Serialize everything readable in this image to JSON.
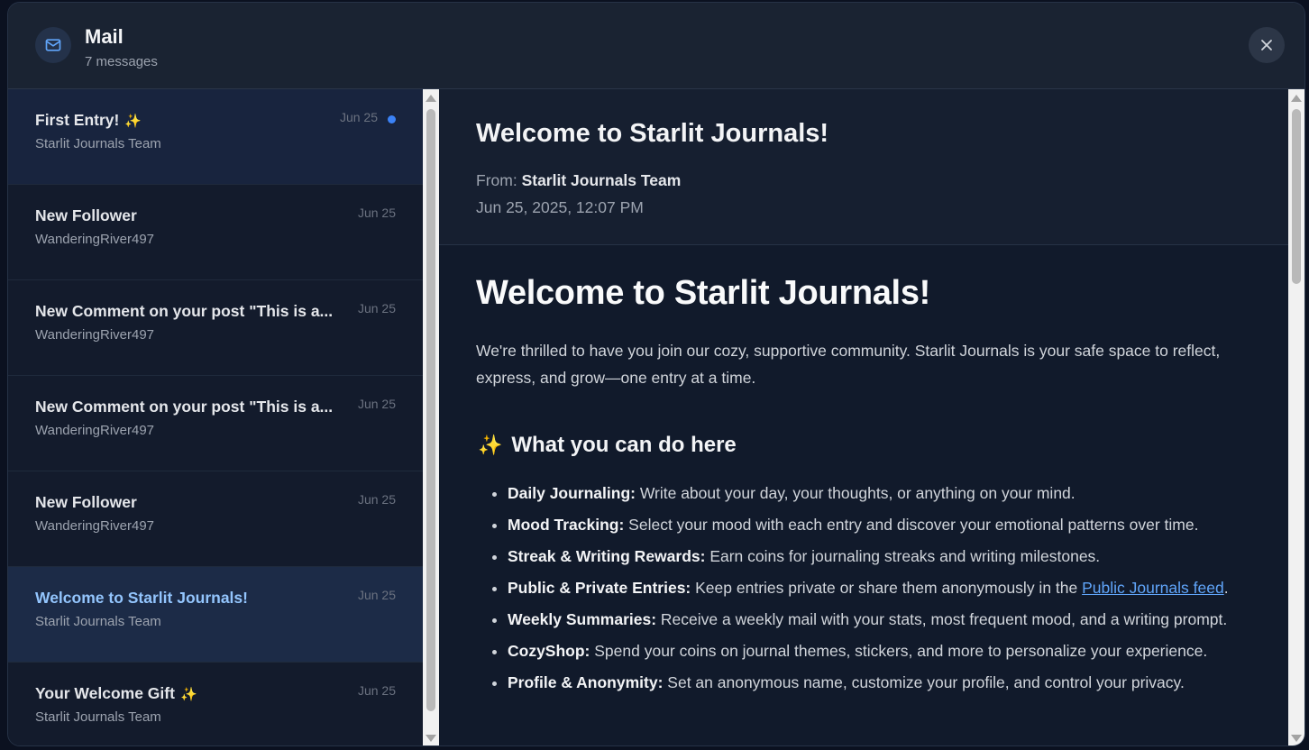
{
  "header": {
    "title": "Mail",
    "subtitle": "7 messages"
  },
  "messages": [
    {
      "subject": "First Entry!",
      "sparkle": "✨",
      "sender": "Starlit Journals Team",
      "date": "Jun 25"
    },
    {
      "subject": "New Follower",
      "sender": "WanderingRiver497",
      "date": "Jun 25"
    },
    {
      "subject": "New Comment on your post \"This is a...",
      "sender": "WanderingRiver497",
      "date": "Jun 25"
    },
    {
      "subject": "New Comment on your post \"This is a...",
      "sender": "WanderingRiver497",
      "date": "Jun 25"
    },
    {
      "subject": "New Follower",
      "sender": "WanderingRiver497",
      "date": "Jun 25"
    },
    {
      "subject": "Welcome to Starlit Journals!",
      "sender": "Starlit Journals Team",
      "date": "Jun 25"
    },
    {
      "subject": "Your Welcome Gift",
      "sparkle": "✨",
      "sender": "Starlit Journals Team",
      "date": "Jun 25"
    }
  ],
  "reader": {
    "title": "Welcome to Starlit Journals!",
    "from_label": "From:",
    "from_name": "Starlit Journals Team",
    "date": "Jun 25, 2025, 12:07 PM",
    "body": {
      "heading": "Welcome to Starlit Journals!",
      "intro": "We're thrilled to have you join our cozy, supportive community. Starlit Journals is your safe space to reflect, express, and grow—one entry at a time.",
      "section_icon": "✨",
      "section_title": "What you can do here",
      "features": [
        {
          "label": "Daily Journaling:",
          "text": " Write about your day, your thoughts, or anything on your mind."
        },
        {
          "label": "Mood Tracking:",
          "text": " Select your mood with each entry and discover your emotional patterns over time."
        },
        {
          "label": "Streak & Writing Rewards:",
          "text": " Earn coins for journaling streaks and writing milestones."
        },
        {
          "label": "Public & Private Entries:",
          "text": " Keep entries private or share them anonymously in the ",
          "link": "Public Journals feed",
          "after": "."
        },
        {
          "label": "Weekly Summaries:",
          "text": " Receive a weekly mail with your stats, most frequent mood, and a writing prompt."
        },
        {
          "label": "CozyShop:",
          "text": " Spend your coins on journal themes, stickers, and more to personalize your experience."
        },
        {
          "label": "Profile & Anonymity:",
          "text": " Set an anonymous name, customize your profile, and control your privacy."
        }
      ]
    }
  },
  "colors": {
    "accent": "#3b82f6",
    "link": "#60a5fa",
    "selected_text": "#93c5fd"
  }
}
